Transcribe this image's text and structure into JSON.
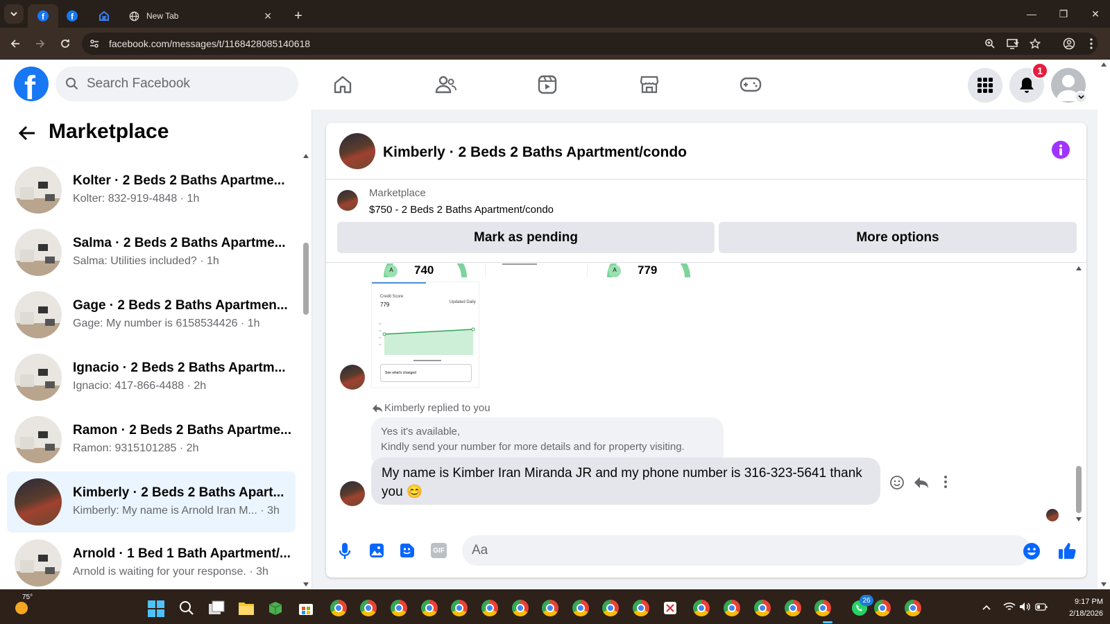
{
  "browser": {
    "tabs": [
      {
        "label": "New Tab"
      }
    ],
    "url": "facebook.com/messages/t/1168428085140618"
  },
  "header": {
    "search_placeholder": "Search Facebook",
    "notification_count": "1"
  },
  "sidebar": {
    "title": "Marketplace",
    "conversations": [
      {
        "name": "Kolter · 2 Beds 2 Baths Apartme...",
        "preview": "Kolter: 832-919-4848 · 1h"
      },
      {
        "name": "Salma · 2 Beds 2 Baths Apartme...",
        "preview": "Salma: Utilities included? · 1h"
      },
      {
        "name": "Gage · 2 Beds 2 Baths Apartmen...",
        "preview": "Gage: My number is 6158534426 · 1h"
      },
      {
        "name": "Ignacio · 2 Beds 2 Baths Apartm...",
        "preview": "Ignacio: 417-866-4488 · 2h"
      },
      {
        "name": "Ramon · 2 Beds 2 Baths Apartme...",
        "preview": "Ramon: 9315101285 · 2h"
      },
      {
        "name": "Kimberly · 2 Beds 2 Baths Apart...",
        "preview": "Kimberly: My name is Arnold Iran M... · 3h"
      },
      {
        "name": "Arnold · 1 Bed 1 Bath Apartment/...",
        "preview": "Arnold is waiting for your response. · 3h"
      }
    ]
  },
  "chat": {
    "title": "Kimberly · 2 Beds 2 Baths Apartment/condo",
    "listing_source": "Marketplace",
    "listing_title": "$750 - 2 Beds 2 Baths Apartment/condo",
    "mark_pending_label": "Mark as pending",
    "more_options_label": "More options",
    "image_scores": [
      "740",
      "779"
    ],
    "image_chart": {
      "label": "Credit Score",
      "value": "779",
      "updated": "Updated Daily",
      "link": "See what's changed"
    },
    "reply_notice": "Kimberly replied to you",
    "quoted_line1": "Yes it's available,",
    "quoted_line2": "Kindly send your number for more details and for property visiting.",
    "message_line1": "My name is Kimber Iran Miranda JR and my phone number is 316-323-5641 thank",
    "message_line2": "you 😊",
    "composer_placeholder": "Aa"
  },
  "taskbar": {
    "weather": "75°",
    "time": "9:17 PM",
    "date": "2/18/2026",
    "whatsapp_badge": "26"
  },
  "colors": {
    "fb_blue": "#1877f2",
    "messenger_blue": "#0866ff",
    "badge_red": "#e41e3f",
    "info_purple": "#a033ff"
  }
}
